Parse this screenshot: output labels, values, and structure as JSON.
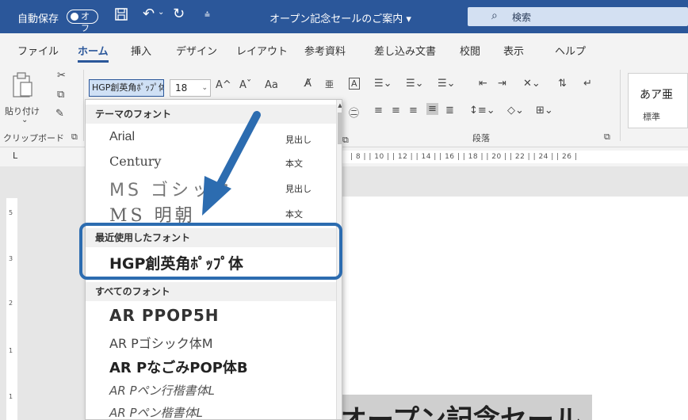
{
  "titlebar": {
    "autosave_label": "自動保存",
    "autosave_state": "オフ",
    "quick_access_icons": [
      "save-icon",
      "undo-icon",
      "redo-icon",
      "customize-icon"
    ],
    "document_title": "オープン記念セールのご案内 ▾",
    "search_placeholder": "検索",
    "background_color": "#2b579a"
  },
  "tabs": [
    {
      "label": "ファイル"
    },
    {
      "label": "ホーム",
      "active": true
    },
    {
      "label": "挿入"
    },
    {
      "label": "デザイン"
    },
    {
      "label": "レイアウト"
    },
    {
      "label": "参考資料"
    },
    {
      "label": "差し込み文書"
    },
    {
      "label": "校閲"
    },
    {
      "label": "表示"
    },
    {
      "label": "ヘルプ"
    }
  ],
  "ribbon": {
    "clipboard": {
      "paste_label": "貼り付け",
      "group_label": "クリップボード"
    },
    "font": {
      "name_value": "HGP創英角ﾎﾟｯﾌﾟ体",
      "size_value": "18",
      "grow": "A^",
      "shrink": "Aˇ",
      "case": "Aa"
    },
    "paragraph": {
      "group_label": "段落"
    },
    "styles": {
      "sample": "あア亜",
      "name": "標準"
    }
  },
  "ruler": {
    "marks": "| 8 |  | 10 |  | 12 |  | 14 |  | 16 |  | 18 |  | 20 |  | 22 |  | 24 |  | 26 |",
    "tab_marker": "L"
  },
  "dropdown": {
    "theme_fonts_header": "テーマのフォント",
    "theme_fonts": [
      {
        "name": "Arial",
        "tag": "見出し"
      },
      {
        "name": "Century",
        "tag": "本文"
      },
      {
        "name": "MS ゴシック",
        "tag": "見出し"
      },
      {
        "name": "MS 明朝",
        "tag": "本文"
      }
    ],
    "recent_header": "最近使用したフォント",
    "recent_fonts": [
      {
        "name": "HGP創英角ﾎﾟｯﾌﾟ体"
      }
    ],
    "all_fonts_header": "すべてのフォント",
    "all_fonts": [
      {
        "name": "AR PPOP5H"
      },
      {
        "name": "AR Pゴシック体M"
      },
      {
        "name": "AR PなごみPOP体B"
      },
      {
        "name": "AR Pペン行楷書体L"
      },
      {
        "name": "AR Pペン楷書体L"
      }
    ]
  },
  "document": {
    "heading_partial": "オープン記念セール"
  },
  "colors": {
    "accent": "#2b579a",
    "highlight_border": "#2c6cb0",
    "arrow": "#2c6cb0"
  }
}
